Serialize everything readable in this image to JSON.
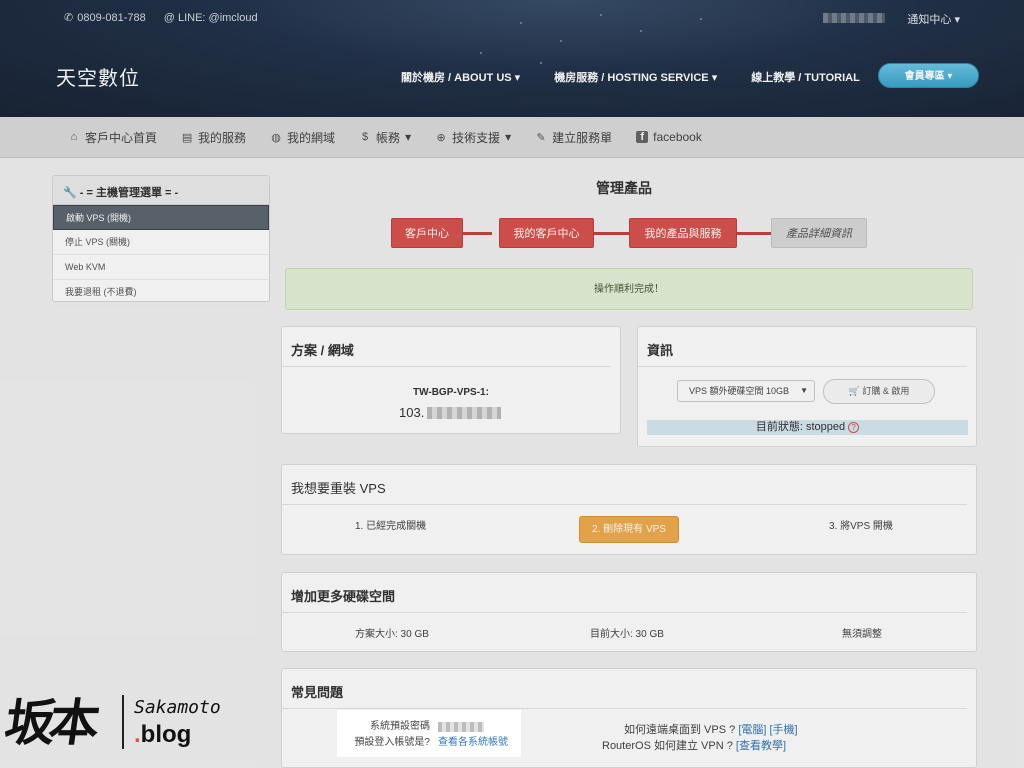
{
  "topbar": {
    "phone": "0809-081-788",
    "line": "@ LINE: @imcloud",
    "notify": "通知中心",
    "brand": "天空數位",
    "nav": [
      "關於機房 / ABOUT US",
      "機房服務 / HOSTING SERVICE",
      "線上教學 / TUTORIAL"
    ],
    "member": "會員專區"
  },
  "subnav": [
    {
      "icon": "home-icon",
      "label": "客戶中心首頁"
    },
    {
      "icon": "list-icon",
      "label": "我的服務"
    },
    {
      "icon": "globe-icon",
      "label": "我的網域"
    },
    {
      "icon": "dollar-icon",
      "label": "帳務"
    },
    {
      "icon": "lifebuoy-icon",
      "label": "技術支援"
    },
    {
      "icon": "edit-icon",
      "label": "建立服務單"
    },
    {
      "icon": "facebook-icon",
      "label": "facebook"
    }
  ],
  "sidebar": {
    "title": "- = 主機管理選單 = -",
    "items": [
      "啟動 VPS (開機)",
      "停止 VPS (關機)",
      "Web KVM",
      "我要退租 (不退費)"
    ]
  },
  "main": {
    "title": "管理產品",
    "breadcrumb": [
      "客戶中心",
      "我的客戶中心",
      "我的產品與服務",
      "產品詳細資訊"
    ],
    "alert": "操作順利完成！",
    "plan": {
      "heading": "方案 / 網域",
      "name": "TW-BGP-VPS-1:",
      "ip_prefix": "103."
    },
    "info": {
      "heading": "資訊",
      "select": "VPS 額外硬碟空間 10GB",
      "order_button": "訂購 & 啟用",
      "status": "目前狀態: stopped",
      "status_q": "?"
    },
    "reinstall": {
      "heading": "我想要重裝 VPS",
      "step1": "1. 已經完成關機",
      "step2": "2. 刪除現有 VPS",
      "step3": "3. 將VPS 開機"
    },
    "disk": {
      "heading": "增加更多硬碟空間",
      "plan_size": "方案大小: 30 GB",
      "current_size": "目前大小: 30 GB",
      "adjust": "無須調整"
    },
    "faq": {
      "heading": "常見問題",
      "pw_label": "系統預設密碼",
      "acct_label": "預設登入帳號是?",
      "acct_link": "查看各系統帳號",
      "q1": "如何遠端桌面到 VPS ?",
      "q1_links": [
        "[電腦]",
        "[手機]"
      ],
      "q2": "RouterOS 如何建立 VPN ?",
      "q2_link": "[查看教學]"
    }
  },
  "watermark": {
    "kanji": "坂本",
    "latin": "Sakamoto",
    "blog_dot": ".",
    "blog": "blog"
  }
}
